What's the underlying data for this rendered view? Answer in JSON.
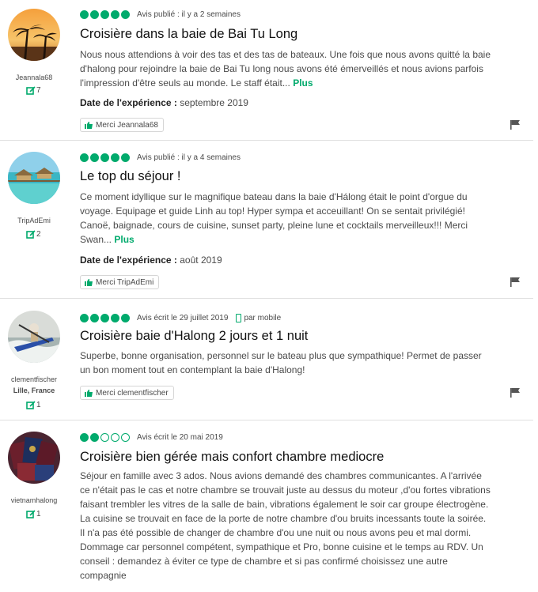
{
  "reviews": [
    {
      "username": "Jeannala68",
      "location": "",
      "contributions": "7",
      "rating": 5,
      "meta": "Avis publié : il y a 2 semaines",
      "mobile": "",
      "title": "Croisière dans la baie de Bai Tu Long",
      "text": "Nous nous attendions à voir des tas et des tas de bateaux. Une fois que nous avons quitté la baie d'halong pour rejoindre la baie de Bai Tu long nous avons été émerveillés et nous avions parfois l'impression d'être seuls au monde. Le staff était...",
      "more": "Plus",
      "date_label": "Date de l'expérience :",
      "date_value": "septembre 2019",
      "thanks": "Merci Jeannala68",
      "avatar_icon": "palm-trees-sunset-avatar"
    },
    {
      "username": "TripAdEmi",
      "location": "",
      "contributions": "2",
      "rating": 5,
      "meta": "Avis publié : il y a 4 semaines",
      "mobile": "",
      "title": "Le top du séjour !",
      "text": "Ce moment idyllique sur le magnifique bateau dans la baie d'Hálong était le point d'orgue du voyage. Equipage et guide Linh au top! Hyper sympa et acceuillant! On se sentait privilégié! Canoë, baignade, cours de cuisine, sunset party, pleine lune et cocktails merveilleux!!! Merci Swan...",
      "more": "Plus",
      "date_label": "Date de l'expérience :",
      "date_value": "août 2019",
      "thanks": "Merci TripAdEmi",
      "avatar_icon": "overwater-bungalow-avatar"
    },
    {
      "username": "clementfischer",
      "location": "Lille, France",
      "contributions": "1",
      "rating": 5,
      "meta": "Avis écrit le 29 juillet 2019",
      "mobile": "par mobile",
      "title": "Croisière baie d'Halong 2 jours et 1 nuit",
      "text": "Superbe, bonne organisation, personnel sur le bateau plus que sympathique! Permet de passer un bon moment tout en contemplant la baie d'Halong!",
      "more": "",
      "date_label": "",
      "date_value": "",
      "thanks": "Merci clementfischer",
      "avatar_icon": "kayaker-avatar"
    },
    {
      "username": "vietnamhalong",
      "location": "",
      "contributions": "1",
      "rating": 2,
      "meta": "Avis écrit le 20 mai 2019",
      "mobile": "",
      "title": "Croisière bien gérée mais confort chambre mediocre",
      "text": "Séjour en famille avec 3 ados. Nous avions demandé des chambres communicantes. A l'arrivée ce n'était pas le cas et notre chambre se trouvait juste au dessus du moteur ,d'ou fortes vibrations faisant trembler les vitres de la salle de bain, vibrations également le soir car groupe électrogène. La cuisine se trouvait en face de la porte de notre chambre d'ou bruits incessants toute la soirée. Il n'a pas été possible de changer de chambre d'ou une nuit ou nous avons peu et mal dormi. Dommage car personnel compétent, sympathique et Pro, bonne cuisine et le temps au RDV. Un conseil : demandez à éviter ce type de chambre et si pas confirmé choisissez une autre compagnie",
      "more": "",
      "date_label": "",
      "date_value": "",
      "thanks": "",
      "avatar_icon": "passports-avatar"
    }
  ],
  "colors": {
    "accent": "#00aa6c",
    "text": "#4a4a4a",
    "title": "#111111",
    "separator": "#e0e0e0"
  }
}
